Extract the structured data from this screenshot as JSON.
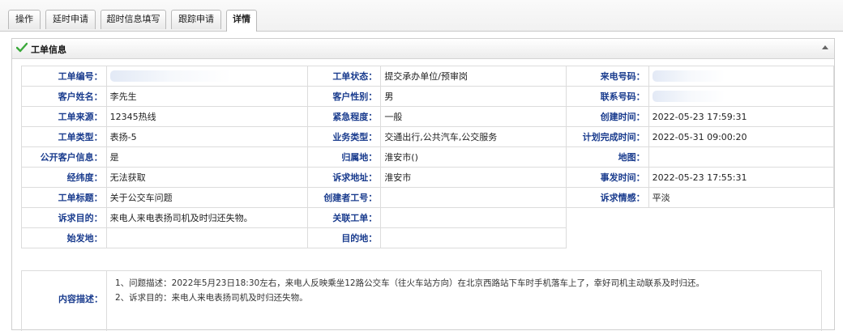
{
  "tabs": [
    {
      "label": "操作"
    },
    {
      "label": "延时申请"
    },
    {
      "label": "超时信息填写"
    },
    {
      "label": "跟踪申请"
    },
    {
      "label": "详情"
    }
  ],
  "panel": {
    "title": "工单信息"
  },
  "rows": [
    [
      {
        "label": "工单编号：",
        "value": ""
      },
      {
        "label": "工单状态：",
        "value": "提交承办单位/预审岗"
      },
      {
        "label": "来电号码：",
        "value": ""
      }
    ],
    [
      {
        "label": "客户姓名：",
        "value": "李先生"
      },
      {
        "label": "客户性别：",
        "value": "男"
      },
      {
        "label": "联系号码：",
        "value": ""
      }
    ],
    [
      {
        "label": "工单来源：",
        "value": "12345热线"
      },
      {
        "label": "紧急程度：",
        "value": "一般"
      },
      {
        "label": "创建时间：",
        "value": "2022-05-23 17:59:31"
      }
    ],
    [
      {
        "label": "工单类型：",
        "value": "表扬-5"
      },
      {
        "label": "业务类型：",
        "value": "交通出行,公共汽车,公交服务"
      },
      {
        "label": "计划完成时间：",
        "value": "2022-05-31 09:00:20"
      }
    ],
    [
      {
        "label": "公开客户信息：",
        "value": "是"
      },
      {
        "label": "归属地：",
        "value": "淮安市()"
      },
      {
        "label": "地图：",
        "value": ""
      }
    ],
    [
      {
        "label": "经纬度：",
        "value": "无法获取"
      },
      {
        "label": "诉求地址：",
        "value": "淮安市"
      },
      {
        "label": "事发时间：",
        "value": "2022-05-23 17:55:31"
      }
    ],
    [
      {
        "label": "工单标题：",
        "value": "关于公交车问题"
      },
      {
        "label": "创建者工号：",
        "value": ""
      },
      {
        "label": "诉求情感：",
        "value": "平淡"
      }
    ],
    [
      {
        "label": "诉求目的：",
        "value": "来电人来电表扬司机及时归还失物。"
      },
      {
        "label": "关联工单：",
        "value": ""
      }
    ],
    [
      {
        "label": "始发地：",
        "value": ""
      },
      {
        "label": "目的地：",
        "value": ""
      }
    ]
  ],
  "content": {
    "label": "内容描述：",
    "line1": "1、问题描述：2022年5月23日18:30左右，来电人反映乘坐12路公交车（往火车站方向）在北京西路站下车时手机落车上了，幸好司机主动联系及时归还。",
    "line2": "2、诉求目的：来电人来电表扬司机及时归还失物。"
  }
}
